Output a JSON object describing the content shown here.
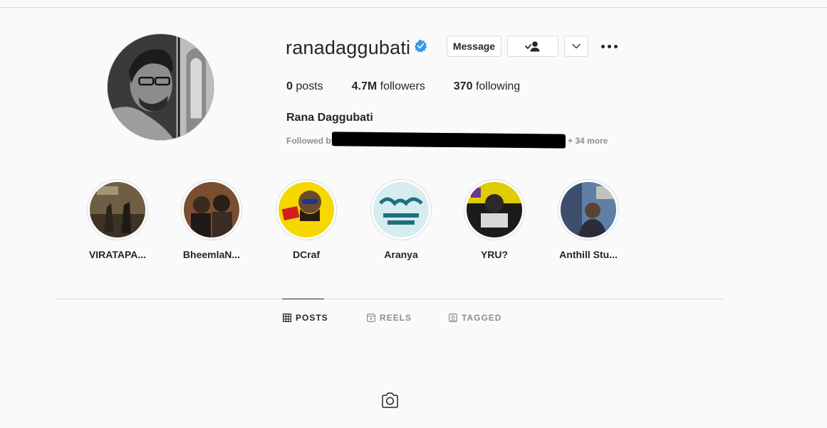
{
  "profile": {
    "username": "ranadaggubati",
    "full_name": "Rana Daggubati",
    "verified": true,
    "stats": [
      {
        "count": "0",
        "label": "posts"
      },
      {
        "count": "4.7M",
        "label": "followers"
      },
      {
        "count": "370",
        "label": "following"
      }
    ],
    "followed_by_prefix": "Followed by",
    "followed_by_suffix": "+ 34 more"
  },
  "actions": {
    "message_label": "Message"
  },
  "highlights": [
    {
      "label": "VIRATAPA...",
      "colors": [
        "#7a6a4c",
        "#3c3226"
      ]
    },
    {
      "label": "BheemlaN...",
      "colors": [
        "#8a5a3a",
        "#2b1e16"
      ]
    },
    {
      "label": "DCraf",
      "colors": [
        "#f5d800",
        "#d11f1f"
      ]
    },
    {
      "label": "Aranya",
      "colors": [
        "#cfe6ec",
        "#2a7f8f"
      ]
    },
    {
      "label": "YRU?",
      "colors": [
        "#e8d400",
        "#1a1a1a"
      ]
    },
    {
      "label": "Anthill Stu...",
      "colors": [
        "#5f7fa6",
        "#2d2d3a"
      ]
    }
  ],
  "tabs": [
    {
      "label": "POSTS",
      "active": true,
      "icon": "grid-icon"
    },
    {
      "label": "REELS",
      "active": false,
      "icon": "reels-icon"
    },
    {
      "label": "TAGGED",
      "active": false,
      "icon": "tagged-icon"
    }
  ],
  "colors": {
    "verified_blue": "#3897f0",
    "text_primary": "#262626",
    "text_secondary": "#8e8e8e",
    "border": "#dbdbdb"
  }
}
